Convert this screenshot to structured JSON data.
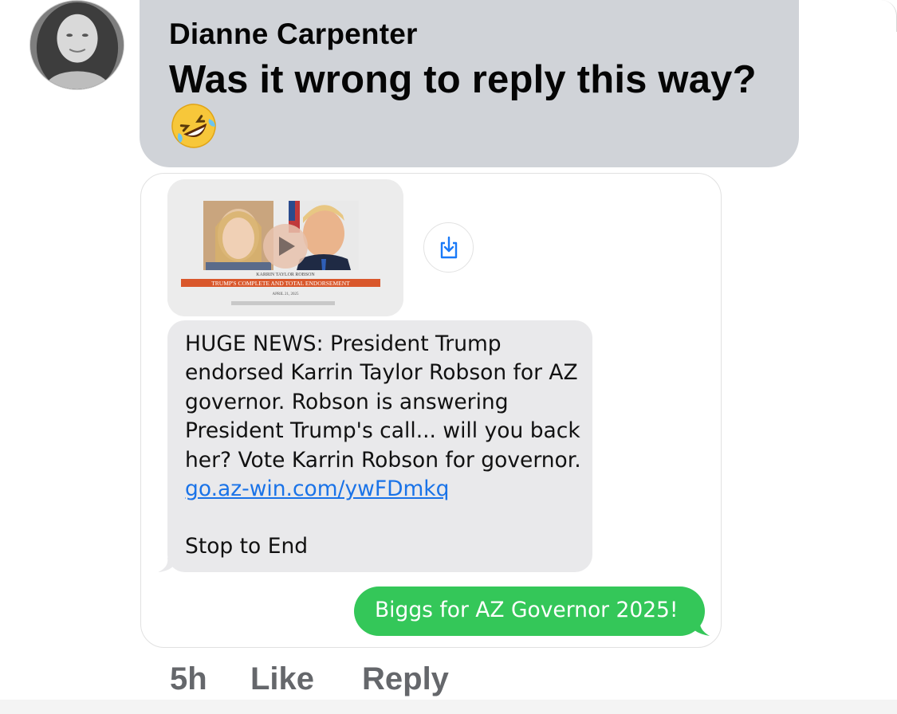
{
  "comment": {
    "author": "Dianne Carpenter",
    "text": "Was it wrong to reply this way?",
    "emoji": "rolling-on-floor-laughing"
  },
  "attachment": {
    "thumbnail": {
      "caption_name": "KARRIN TAYLOR ROBSON",
      "caption_banner": "TRUMP'S COMPLETE AND TOTAL ENDORSEMENT",
      "caption_date": "APRIL 21, 2025"
    },
    "incoming_message": {
      "text": "HUGE NEWS: President Trump endorsed Karrin Taylor Robson for AZ governor. Robson is answering President Trump's call... will you back her? Vote Karrin Robson for governor.",
      "link": "go.az-win.com/ywFDmkq",
      "footer": "Stop to End"
    },
    "outgoing_message": {
      "text": "Biggs for AZ Governor 2025!"
    },
    "colors": {
      "incoming_bubble": "#e9e9eb",
      "outgoing_bubble": "#34c759",
      "link": "#1a73e8"
    }
  },
  "actions": {
    "time": "5h",
    "like": "Like",
    "reply": "Reply"
  },
  "colors": {
    "comment_bubble": "#d0d3d8",
    "action_text": "#65676b"
  }
}
